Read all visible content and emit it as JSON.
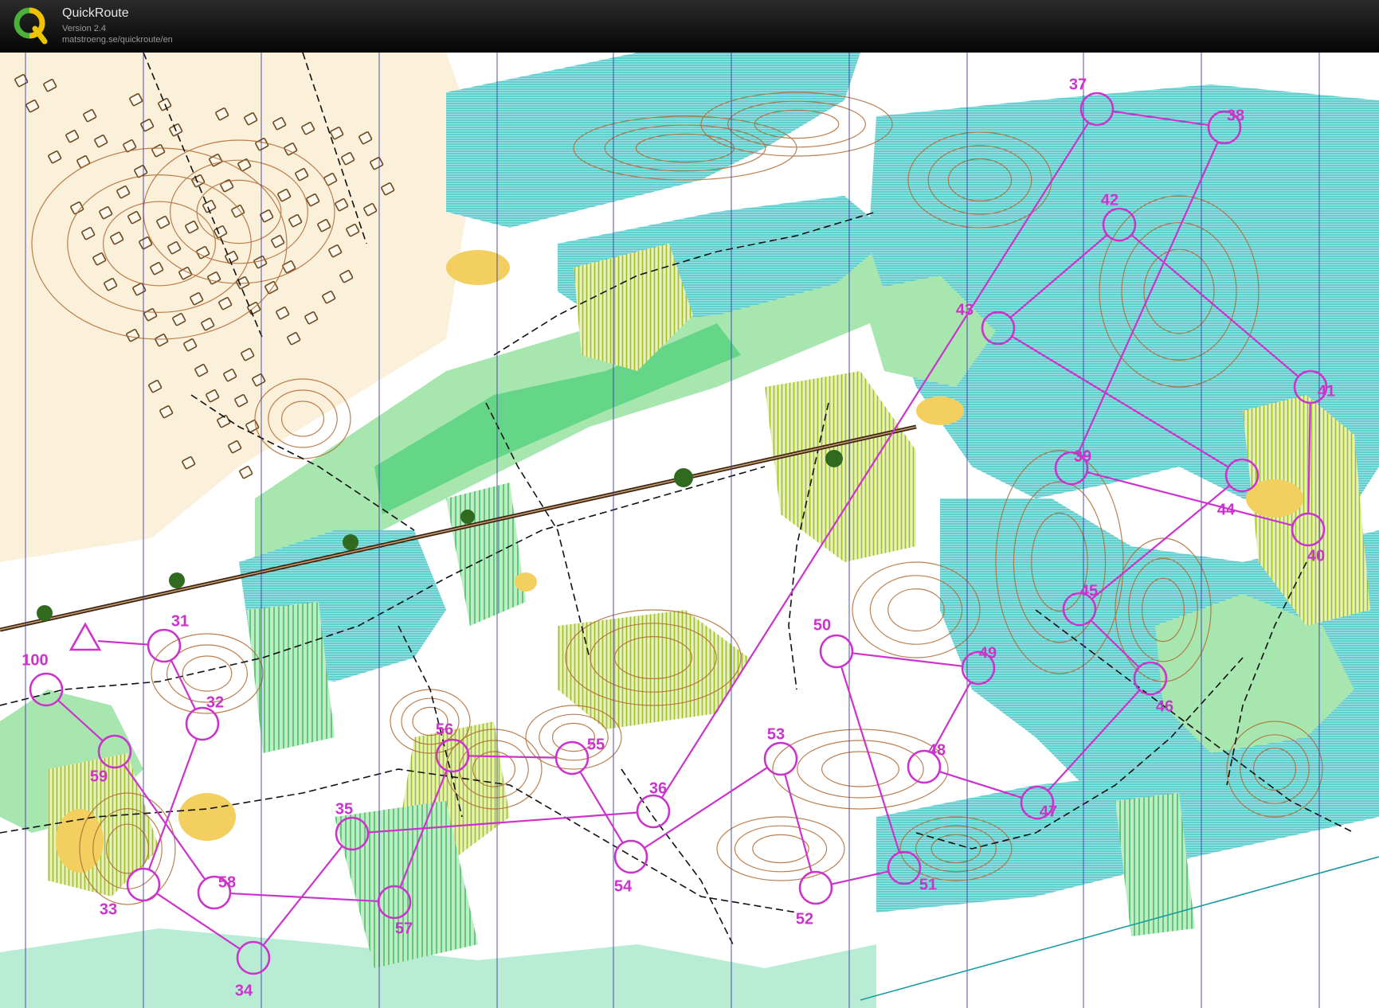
{
  "app": {
    "title": "QuickRoute",
    "version": "Version 2.4",
    "url": "matstroeng.se/quickroute/en"
  },
  "colors": {
    "course": "#cc33cc",
    "open": "#ffffff",
    "forest_green_light": "#a8e6b0",
    "forest_green_mid": "#4fd07a",
    "marsh_blue": "#3fc4c8",
    "yellow_open": "#f2cf5e",
    "contour_brown": "#b06a34",
    "meridian_blue": "#3a3aa8"
  },
  "course": {
    "start_label": "100",
    "controls": [
      {
        "label": "31"
      },
      {
        "label": "32"
      },
      {
        "label": "33"
      },
      {
        "label": "34"
      },
      {
        "label": "35"
      },
      {
        "label": "36"
      },
      {
        "label": "37"
      },
      {
        "label": "38"
      },
      {
        "label": "39"
      },
      {
        "label": "40"
      },
      {
        "label": "41"
      },
      {
        "label": "42"
      },
      {
        "label": "43"
      },
      {
        "label": "44"
      },
      {
        "label": "45"
      },
      {
        "label": "46"
      },
      {
        "label": "47"
      },
      {
        "label": "48"
      },
      {
        "label": "49"
      },
      {
        "label": "50"
      },
      {
        "label": "51"
      },
      {
        "label": "52"
      },
      {
        "label": "53"
      },
      {
        "label": "54"
      },
      {
        "label": "55"
      },
      {
        "label": "56"
      },
      {
        "label": "57"
      },
      {
        "label": "58"
      },
      {
        "label": "59"
      },
      {
        "label": "100"
      }
    ]
  }
}
